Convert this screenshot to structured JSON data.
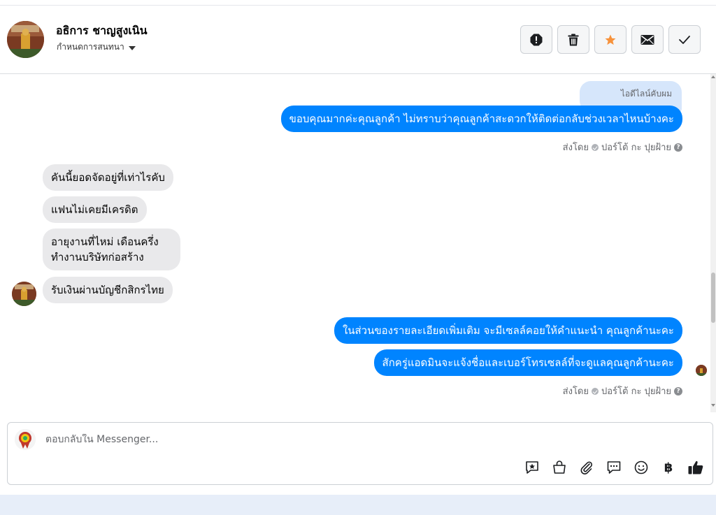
{
  "header": {
    "contact_name": "อธิการ ชาญสูงเนิน",
    "assign_label": "กำหนดการสนทนา",
    "actions": [
      {
        "name": "spam-button",
        "icon": "alert-octagon-icon"
      },
      {
        "name": "delete-button",
        "icon": "trash-icon"
      },
      {
        "name": "star-button",
        "icon": "star-icon",
        "color": "#f7923b"
      },
      {
        "name": "mark-unread-button",
        "icon": "envelope-icon"
      },
      {
        "name": "done-button",
        "icon": "check-icon"
      }
    ]
  },
  "conversation": {
    "reply_chip": "ไอดีไลน์คับผม",
    "messages_out_1": [
      "ขอบคุณมากค่ะคุณลูกค้า ไม่ทราบว่าคุณลูกค้าสะดวกให้ติดต่อกลับช่วงเวลาไหนบ้างคะ"
    ],
    "sent_by_1": "ส่งโดย",
    "sender_1": "ปอร์โต้ กะ ปุยฝ้าย",
    "messages_in": [
      "คันนี้ยอดจัดอยู่ที่เท่าไรคับ",
      "แฟนไม่เคยมีเครดิต",
      "อายุงานที่ไหม่ เดือนครึ่ง",
      "ทำงานบริษัทก่อสร้าง",
      "รับเงินผ่านบัญชีกสิกรไทย"
    ],
    "messages_out_2": [
      "ในส่วนของรายละเอียดเพิ่มเติม จะมีเซลล์คอยให้คำแนะนำ คุณลูกค้านะคะ",
      "สักครู่แอดมินจะแจ้งชื่อและเบอร์โทรเซลล์ที่จะดูแลคุณลูกค้านะคะ"
    ],
    "sent_by_2": "ส่งโดย",
    "sender_2": "ปอร์โต้ กะ ปุยฝ้าย",
    "help_glyph": "?"
  },
  "composer": {
    "placeholder": "ตอบกลับใน Messenger...",
    "tools": [
      "saved-reply-icon",
      "shop-icon",
      "attachment-icon",
      "quick-reply-icon",
      "emoji-icon",
      "baht-icon",
      "like-icon"
    ],
    "baht_glyph": "฿"
  },
  "colors": {
    "accent_blue": "#0084ff",
    "incoming_bubble": "#e9e9eb",
    "star": "#f7923b"
  }
}
